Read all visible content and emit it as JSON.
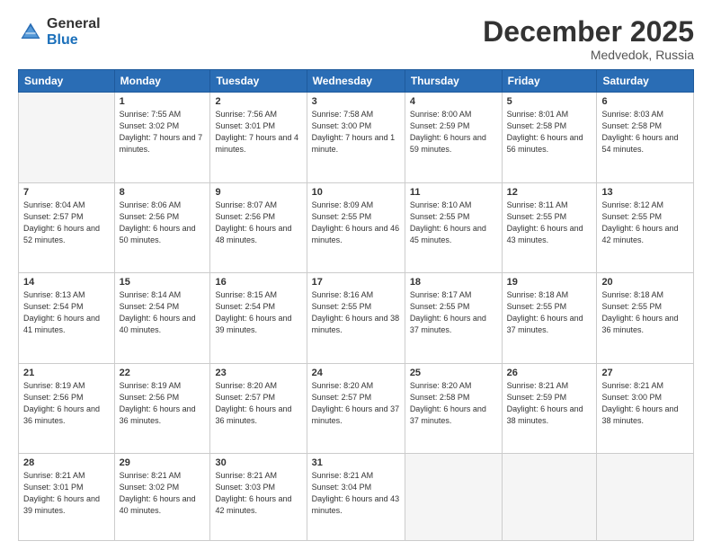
{
  "header": {
    "logo_general": "General",
    "logo_blue": "Blue",
    "month": "December 2025",
    "location": "Medvedok, Russia"
  },
  "days_of_week": [
    "Sunday",
    "Monday",
    "Tuesday",
    "Wednesday",
    "Thursday",
    "Friday",
    "Saturday"
  ],
  "weeks": [
    [
      {
        "day": "",
        "empty": true
      },
      {
        "day": "1",
        "sunrise": "Sunrise: 7:55 AM",
        "sunset": "Sunset: 3:02 PM",
        "daylight": "Daylight: 7 hours and 7 minutes."
      },
      {
        "day": "2",
        "sunrise": "Sunrise: 7:56 AM",
        "sunset": "Sunset: 3:01 PM",
        "daylight": "Daylight: 7 hours and 4 minutes."
      },
      {
        "day": "3",
        "sunrise": "Sunrise: 7:58 AM",
        "sunset": "Sunset: 3:00 PM",
        "daylight": "Daylight: 7 hours and 1 minute."
      },
      {
        "day": "4",
        "sunrise": "Sunrise: 8:00 AM",
        "sunset": "Sunset: 2:59 PM",
        "daylight": "Daylight: 6 hours and 59 minutes."
      },
      {
        "day": "5",
        "sunrise": "Sunrise: 8:01 AM",
        "sunset": "Sunset: 2:58 PM",
        "daylight": "Daylight: 6 hours and 56 minutes."
      },
      {
        "day": "6",
        "sunrise": "Sunrise: 8:03 AM",
        "sunset": "Sunset: 2:58 PM",
        "daylight": "Daylight: 6 hours and 54 minutes."
      }
    ],
    [
      {
        "day": "7",
        "sunrise": "Sunrise: 8:04 AM",
        "sunset": "Sunset: 2:57 PM",
        "daylight": "Daylight: 6 hours and 52 minutes."
      },
      {
        "day": "8",
        "sunrise": "Sunrise: 8:06 AM",
        "sunset": "Sunset: 2:56 PM",
        "daylight": "Daylight: 6 hours and 50 minutes."
      },
      {
        "day": "9",
        "sunrise": "Sunrise: 8:07 AM",
        "sunset": "Sunset: 2:56 PM",
        "daylight": "Daylight: 6 hours and 48 minutes."
      },
      {
        "day": "10",
        "sunrise": "Sunrise: 8:09 AM",
        "sunset": "Sunset: 2:55 PM",
        "daylight": "Daylight: 6 hours and 46 minutes."
      },
      {
        "day": "11",
        "sunrise": "Sunrise: 8:10 AM",
        "sunset": "Sunset: 2:55 PM",
        "daylight": "Daylight: 6 hours and 45 minutes."
      },
      {
        "day": "12",
        "sunrise": "Sunrise: 8:11 AM",
        "sunset": "Sunset: 2:55 PM",
        "daylight": "Daylight: 6 hours and 43 minutes."
      },
      {
        "day": "13",
        "sunrise": "Sunrise: 8:12 AM",
        "sunset": "Sunset: 2:55 PM",
        "daylight": "Daylight: 6 hours and 42 minutes."
      }
    ],
    [
      {
        "day": "14",
        "sunrise": "Sunrise: 8:13 AM",
        "sunset": "Sunset: 2:54 PM",
        "daylight": "Daylight: 6 hours and 41 minutes."
      },
      {
        "day": "15",
        "sunrise": "Sunrise: 8:14 AM",
        "sunset": "Sunset: 2:54 PM",
        "daylight": "Daylight: 6 hours and 40 minutes."
      },
      {
        "day": "16",
        "sunrise": "Sunrise: 8:15 AM",
        "sunset": "Sunset: 2:54 PM",
        "daylight": "Daylight: 6 hours and 39 minutes."
      },
      {
        "day": "17",
        "sunrise": "Sunrise: 8:16 AM",
        "sunset": "Sunset: 2:55 PM",
        "daylight": "Daylight: 6 hours and 38 minutes."
      },
      {
        "day": "18",
        "sunrise": "Sunrise: 8:17 AM",
        "sunset": "Sunset: 2:55 PM",
        "daylight": "Daylight: 6 hours and 37 minutes."
      },
      {
        "day": "19",
        "sunrise": "Sunrise: 8:18 AM",
        "sunset": "Sunset: 2:55 PM",
        "daylight": "Daylight: 6 hours and 37 minutes."
      },
      {
        "day": "20",
        "sunrise": "Sunrise: 8:18 AM",
        "sunset": "Sunset: 2:55 PM",
        "daylight": "Daylight: 6 hours and 36 minutes."
      }
    ],
    [
      {
        "day": "21",
        "sunrise": "Sunrise: 8:19 AM",
        "sunset": "Sunset: 2:56 PM",
        "daylight": "Daylight: 6 hours and 36 minutes."
      },
      {
        "day": "22",
        "sunrise": "Sunrise: 8:19 AM",
        "sunset": "Sunset: 2:56 PM",
        "daylight": "Daylight: 6 hours and 36 minutes."
      },
      {
        "day": "23",
        "sunrise": "Sunrise: 8:20 AM",
        "sunset": "Sunset: 2:57 PM",
        "daylight": "Daylight: 6 hours and 36 minutes."
      },
      {
        "day": "24",
        "sunrise": "Sunrise: 8:20 AM",
        "sunset": "Sunset: 2:57 PM",
        "daylight": "Daylight: 6 hours and 37 minutes."
      },
      {
        "day": "25",
        "sunrise": "Sunrise: 8:20 AM",
        "sunset": "Sunset: 2:58 PM",
        "daylight": "Daylight: 6 hours and 37 minutes."
      },
      {
        "day": "26",
        "sunrise": "Sunrise: 8:21 AM",
        "sunset": "Sunset: 2:59 PM",
        "daylight": "Daylight: 6 hours and 38 minutes."
      },
      {
        "day": "27",
        "sunrise": "Sunrise: 8:21 AM",
        "sunset": "Sunset: 3:00 PM",
        "daylight": "Daylight: 6 hours and 38 minutes."
      }
    ],
    [
      {
        "day": "28",
        "sunrise": "Sunrise: 8:21 AM",
        "sunset": "Sunset: 3:01 PM",
        "daylight": "Daylight: 6 hours and 39 minutes."
      },
      {
        "day": "29",
        "sunrise": "Sunrise: 8:21 AM",
        "sunset": "Sunset: 3:02 PM",
        "daylight": "Daylight: 6 hours and 40 minutes."
      },
      {
        "day": "30",
        "sunrise": "Sunrise: 8:21 AM",
        "sunset": "Sunset: 3:03 PM",
        "daylight": "Daylight: 6 hours and 42 minutes."
      },
      {
        "day": "31",
        "sunrise": "Sunrise: 8:21 AM",
        "sunset": "Sunset: 3:04 PM",
        "daylight": "Daylight: 6 hours and 43 minutes."
      },
      {
        "day": "",
        "empty": true
      },
      {
        "day": "",
        "empty": true
      },
      {
        "day": "",
        "empty": true
      }
    ]
  ]
}
